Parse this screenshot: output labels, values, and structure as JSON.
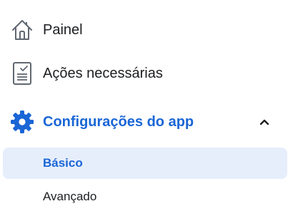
{
  "sidebar": {
    "items": [
      {
        "label": "Painel",
        "icon": "home-icon"
      },
      {
        "label": "Ações necessárias",
        "icon": "checklist-icon"
      },
      {
        "label": "Configurações do app",
        "icon": "gear-icon",
        "expanded": true,
        "active": true,
        "children": [
          {
            "label": "Básico",
            "selected": true
          },
          {
            "label": "Avançado",
            "selected": false
          }
        ]
      }
    ]
  },
  "colors": {
    "accent": "#1a66d6",
    "selected_bg": "#e6eefc",
    "text": "#1c1e21",
    "icon_gray": "#606770"
  }
}
